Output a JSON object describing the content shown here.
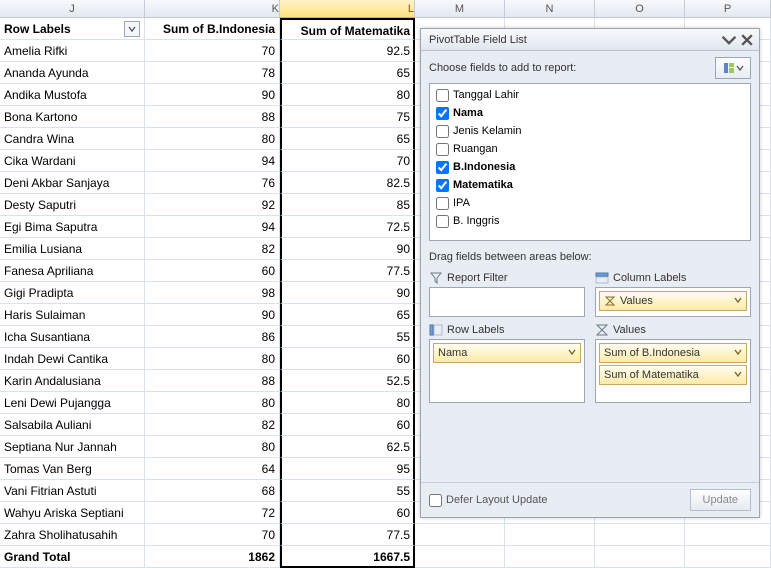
{
  "columns": [
    "J",
    "K",
    "L",
    "M",
    "N",
    "O",
    "P"
  ],
  "selected_column": "L",
  "pivot": {
    "headers": {
      "row_labels": "Row Labels",
      "sum_bindonesia": "Sum of B.Indonesia",
      "sum_matematika": "Sum of Matematika"
    },
    "rows": [
      {
        "name": "Amelia Rifki",
        "bi": 70,
        "mat": 92.5
      },
      {
        "name": "Ananda Ayunda",
        "bi": 78,
        "mat": 65
      },
      {
        "name": "Andika Mustofa",
        "bi": 90,
        "mat": 80
      },
      {
        "name": "Bona Kartono",
        "bi": 88,
        "mat": 75
      },
      {
        "name": "Candra Wina",
        "bi": 80,
        "mat": 65
      },
      {
        "name": "Cika Wardani",
        "bi": 94,
        "mat": 70
      },
      {
        "name": "Deni Akbar Sanjaya",
        "bi": 76,
        "mat": 82.5
      },
      {
        "name": "Desty Saputri",
        "bi": 92,
        "mat": 85
      },
      {
        "name": "Egi Bima Saputra",
        "bi": 94,
        "mat": 72.5
      },
      {
        "name": "Emilia Lusiana",
        "bi": 82,
        "mat": 90
      },
      {
        "name": "Fanesa Apriliana",
        "bi": 60,
        "mat": 77.5
      },
      {
        "name": "Gigi Pradipta",
        "bi": 98,
        "mat": 90
      },
      {
        "name": "Haris Sulaiman",
        "bi": 90,
        "mat": 65
      },
      {
        "name": "Icha Susantiana",
        "bi": 86,
        "mat": 55
      },
      {
        "name": "Indah Dewi Cantika",
        "bi": 80,
        "mat": 60
      },
      {
        "name": "Karin Andalusiana",
        "bi": 88,
        "mat": 52.5
      },
      {
        "name": "Leni Dewi Pujangga",
        "bi": 80,
        "mat": 80
      },
      {
        "name": "Salsabila Auliani",
        "bi": 82,
        "mat": 60
      },
      {
        "name": "Septiana Nur Jannah",
        "bi": 80,
        "mat": 62.5
      },
      {
        "name": "Tomas Van Berg",
        "bi": 64,
        "mat": 95
      },
      {
        "name": "Vani Fitrian Astuti",
        "bi": 68,
        "mat": 55
      },
      {
        "name": "Wahyu Ariska Septiani",
        "bi": 72,
        "mat": 60
      },
      {
        "name": "Zahra Sholihatusahih",
        "bi": 70,
        "mat": 77.5
      }
    ],
    "grand_total": {
      "label": "Grand Total",
      "bi": 1862,
      "mat": 1667.5
    }
  },
  "panel": {
    "title": "PivotTable Field List",
    "choose_label": "Choose fields to add to report:",
    "fields": [
      {
        "label": "Tanggal Lahir",
        "checked": false
      },
      {
        "label": "Nama",
        "checked": true
      },
      {
        "label": "Jenis Kelamin",
        "checked": false
      },
      {
        "label": "Ruangan",
        "checked": false
      },
      {
        "label": "B.Indonesia",
        "checked": true
      },
      {
        "label": "Matematika",
        "checked": true
      },
      {
        "label": "IPA",
        "checked": false
      },
      {
        "label": "B. Inggris",
        "checked": false
      }
    ],
    "drag_label": "Drag fields between areas below:",
    "zones": {
      "report_filter": "Report Filter",
      "column_labels": "Column Labels",
      "row_labels": "Row Labels",
      "values": "Values"
    },
    "chips": {
      "col_values": "Values",
      "row_nama": "Nama",
      "val_bi": "Sum of B.Indonesia",
      "val_mat": "Sum of Matematika"
    },
    "defer_label": "Defer Layout Update",
    "update_label": "Update"
  }
}
